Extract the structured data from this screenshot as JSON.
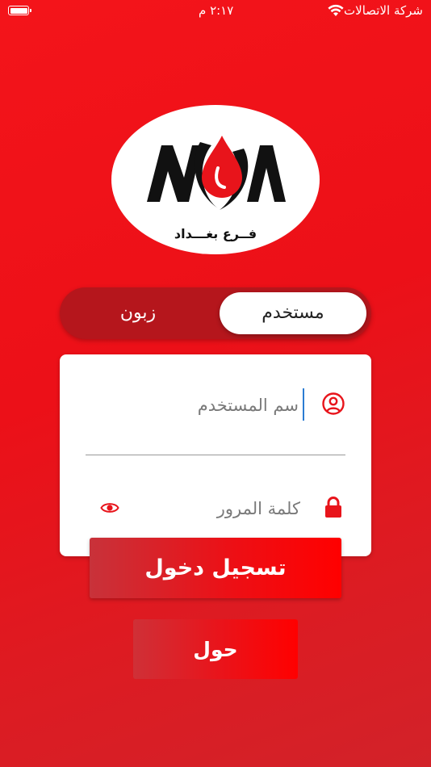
{
  "status_bar": {
    "carrier": "شركة الاتصالات",
    "time": "٢:١٧ م",
    "battery_icon": "battery-icon",
    "wifi_icon": "wifi-icon"
  },
  "logo": {
    "brand_text": "NOA",
    "caption": "فــرع بغـــداد"
  },
  "segmented": {
    "active_label": "مستخدم",
    "inactive_label": "زبون"
  },
  "form": {
    "username_placeholder": "سم المستخدم",
    "password_placeholder": "كلمة المرور",
    "username_icon": "user-circle-icon",
    "password_icon": "lock-icon",
    "toggle_icon": "eye-icon"
  },
  "buttons": {
    "login": "تسجيل دخول",
    "about": "حول"
  },
  "colors": {
    "primary": "#ee1118",
    "segment_track": "#b5161c",
    "caret": "#2b7cd3"
  }
}
